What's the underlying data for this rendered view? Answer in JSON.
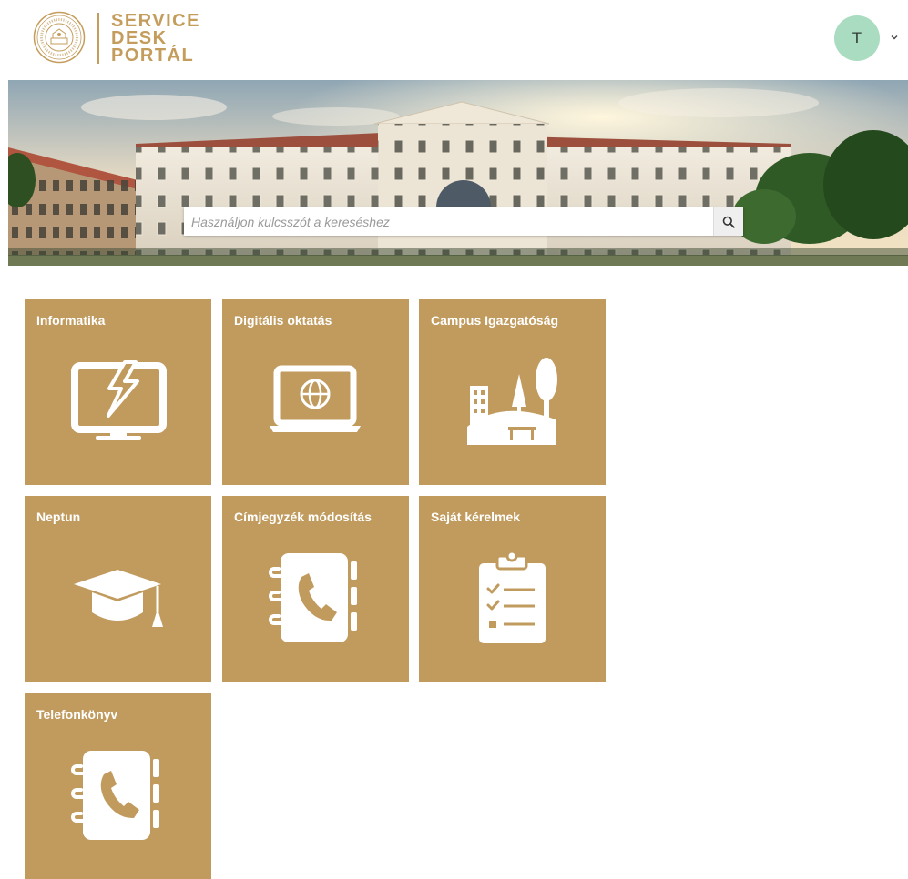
{
  "header": {
    "logo_line1": "SERVICE",
    "logo_line2": "DESK",
    "logo_line3": "PORTÁL",
    "user_initial": "T"
  },
  "search": {
    "placeholder": "Használjon kulcsszót a kereséshez",
    "value": ""
  },
  "tiles": [
    {
      "label": "Informatika",
      "icon": "monitor-lightning-icon"
    },
    {
      "label": "Digitális oktatás",
      "icon": "laptop-globe-icon"
    },
    {
      "label": "Campus Igazgatóság",
      "icon": "campus-park-icon"
    },
    {
      "label": "Neptun",
      "icon": "graduation-cap-icon"
    },
    {
      "label": "Címjegyzék módosítás",
      "icon": "address-book-phone-icon"
    },
    {
      "label": "Saját kérelmek",
      "icon": "clipboard-checklist-icon"
    },
    {
      "label": "Telefonkönyv",
      "icon": "address-book-phone-icon"
    }
  ],
  "colors": {
    "accent": "#c49c5c",
    "tile": "#c19b5e",
    "avatar": "#a9dcc0"
  }
}
